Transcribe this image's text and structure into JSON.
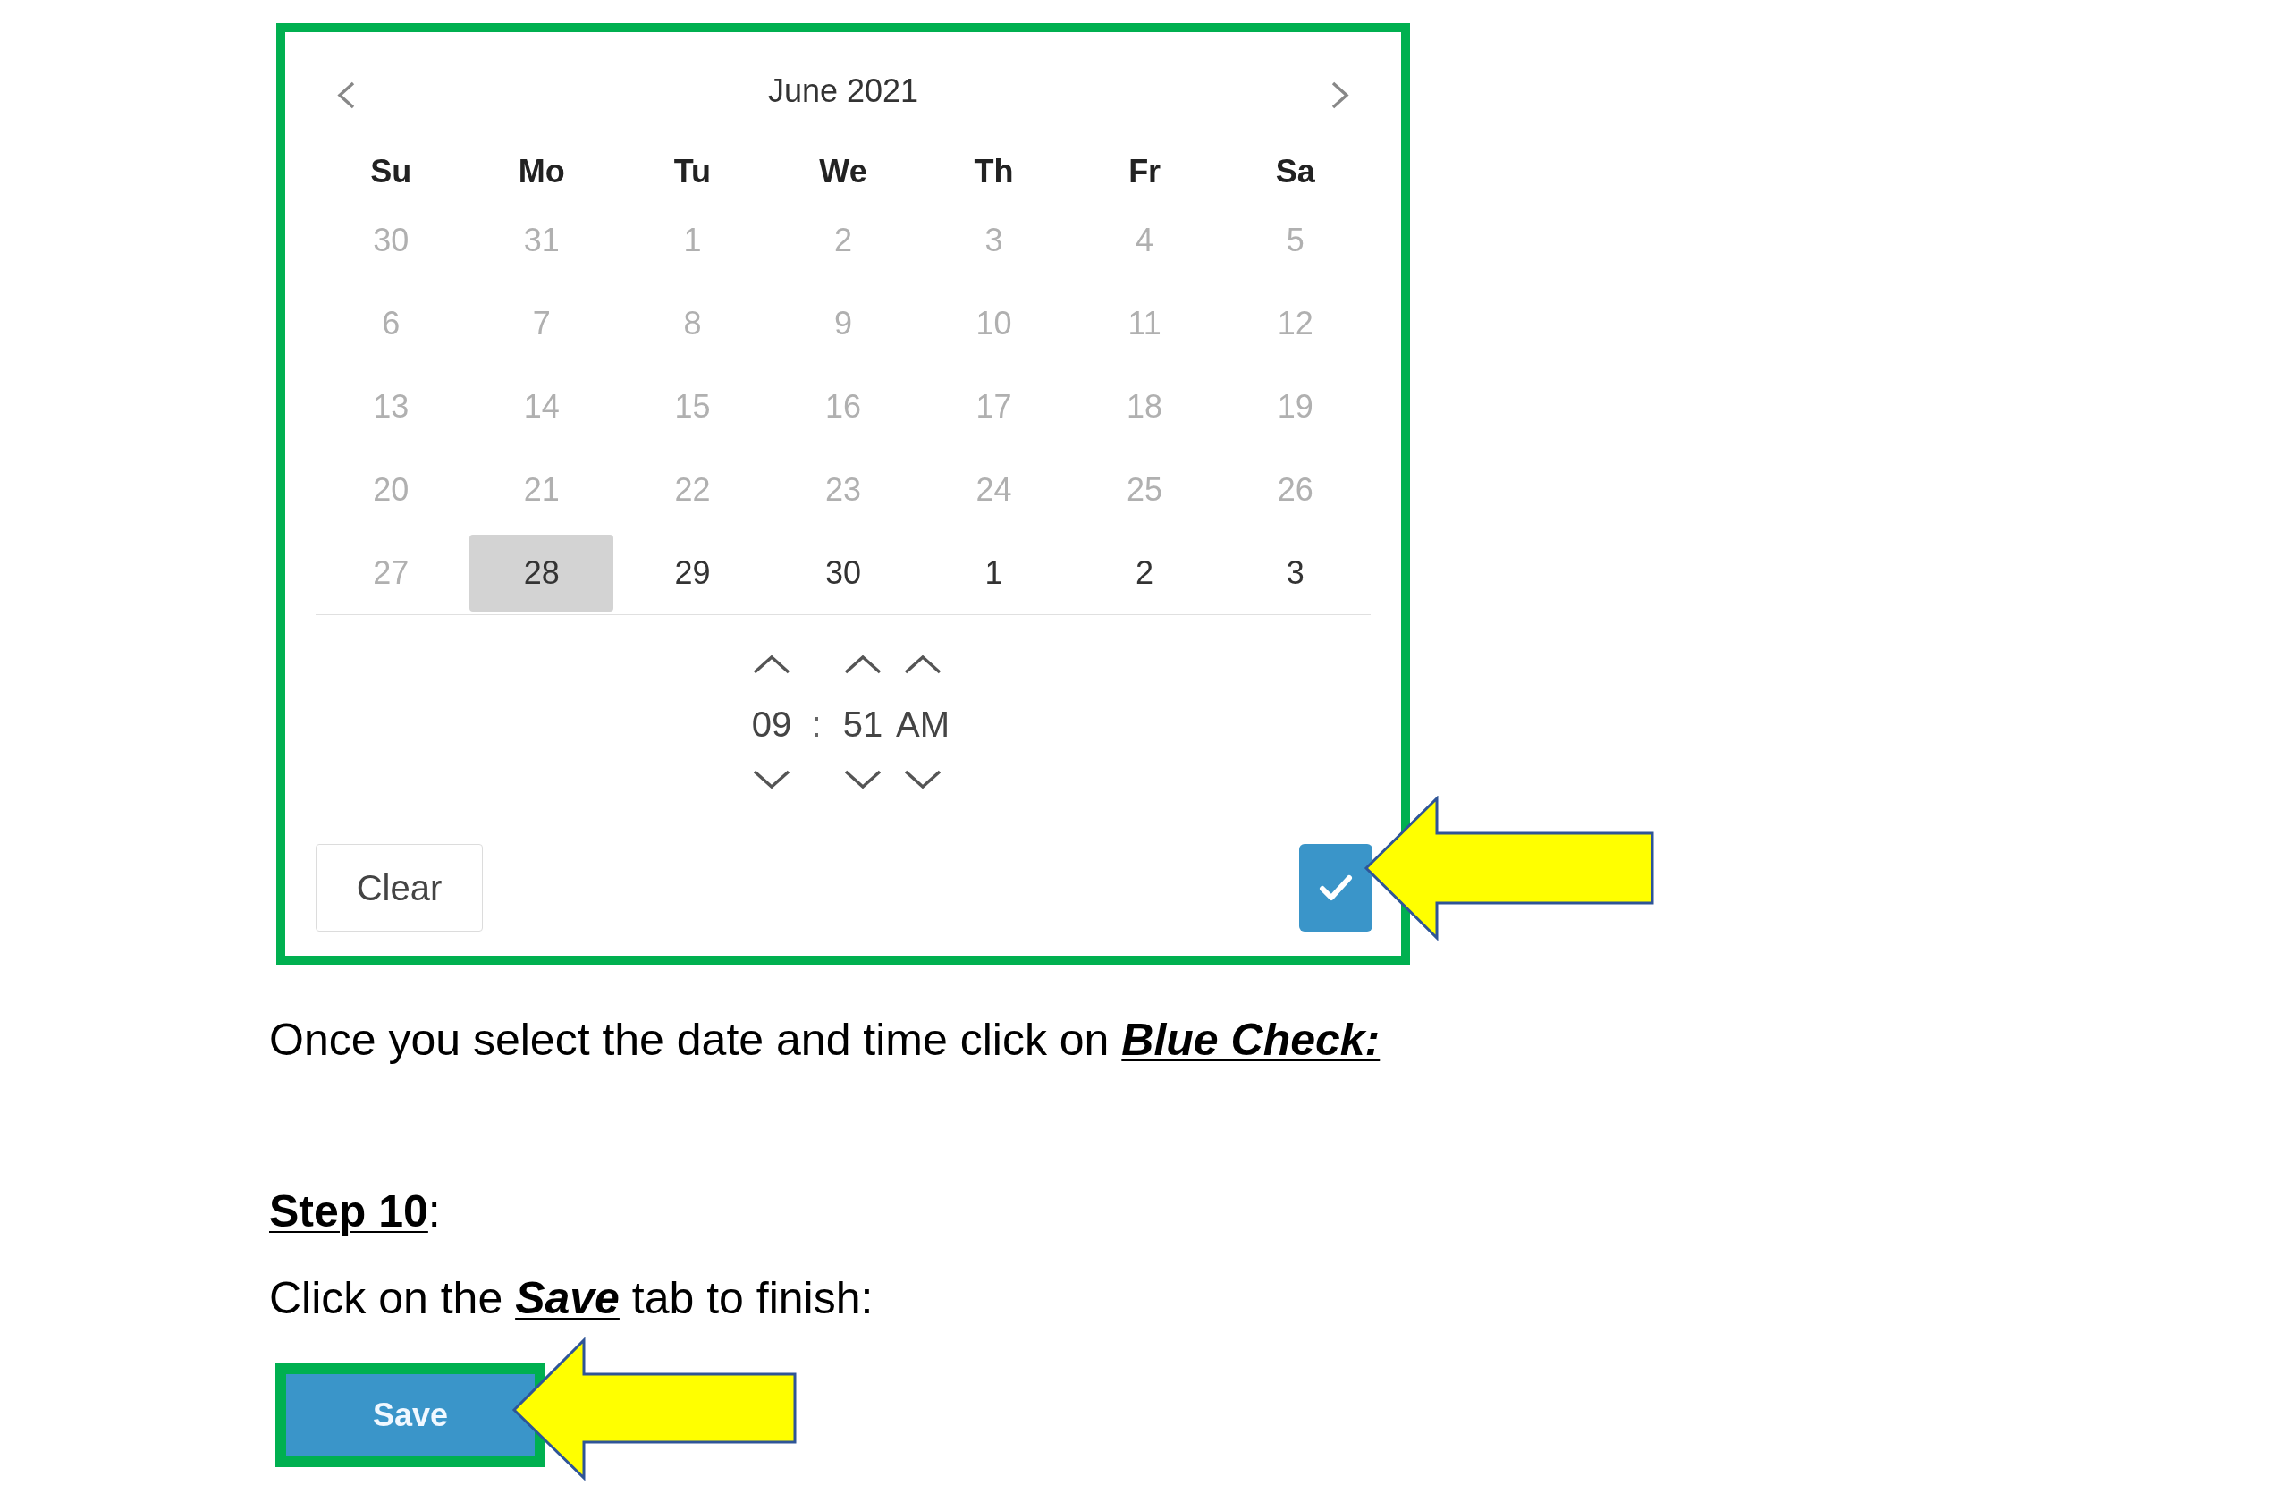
{
  "calendar": {
    "title": "June 2021",
    "weekdays": [
      "Su",
      "Mo",
      "Tu",
      "We",
      "Th",
      "Fr",
      "Sa"
    ],
    "weeks": [
      [
        {
          "label": "30",
          "disabled": true,
          "selected": false
        },
        {
          "label": "31",
          "disabled": true,
          "selected": false
        },
        {
          "label": "1",
          "disabled": true,
          "selected": false
        },
        {
          "label": "2",
          "disabled": true,
          "selected": false
        },
        {
          "label": "3",
          "disabled": true,
          "selected": false
        },
        {
          "label": "4",
          "disabled": true,
          "selected": false
        },
        {
          "label": "5",
          "disabled": true,
          "selected": false
        }
      ],
      [
        {
          "label": "6",
          "disabled": true,
          "selected": false
        },
        {
          "label": "7",
          "disabled": true,
          "selected": false
        },
        {
          "label": "8",
          "disabled": true,
          "selected": false
        },
        {
          "label": "9",
          "disabled": true,
          "selected": false
        },
        {
          "label": "10",
          "disabled": true,
          "selected": false
        },
        {
          "label": "11",
          "disabled": true,
          "selected": false
        },
        {
          "label": "12",
          "disabled": true,
          "selected": false
        }
      ],
      [
        {
          "label": "13",
          "disabled": true,
          "selected": false
        },
        {
          "label": "14",
          "disabled": true,
          "selected": false
        },
        {
          "label": "15",
          "disabled": true,
          "selected": false
        },
        {
          "label": "16",
          "disabled": true,
          "selected": false
        },
        {
          "label": "17",
          "disabled": true,
          "selected": false
        },
        {
          "label": "18",
          "disabled": true,
          "selected": false
        },
        {
          "label": "19",
          "disabled": true,
          "selected": false
        }
      ],
      [
        {
          "label": "20",
          "disabled": true,
          "selected": false
        },
        {
          "label": "21",
          "disabled": true,
          "selected": false
        },
        {
          "label": "22",
          "disabled": true,
          "selected": false
        },
        {
          "label": "23",
          "disabled": true,
          "selected": false
        },
        {
          "label": "24",
          "disabled": true,
          "selected": false
        },
        {
          "label": "25",
          "disabled": true,
          "selected": false
        },
        {
          "label": "26",
          "disabled": true,
          "selected": false
        }
      ],
      [
        {
          "label": "27",
          "disabled": true,
          "selected": false
        },
        {
          "label": "28",
          "disabled": false,
          "selected": true
        },
        {
          "label": "29",
          "disabled": false,
          "selected": false
        },
        {
          "label": "30",
          "disabled": false,
          "selected": false
        },
        {
          "label": "1",
          "disabled": false,
          "selected": false
        },
        {
          "label": "2",
          "disabled": false,
          "selected": false
        },
        {
          "label": "3",
          "disabled": false,
          "selected": false
        }
      ]
    ]
  },
  "time_picker": {
    "hour": "09",
    "separator": ":",
    "minute": "51",
    "period": "AM"
  },
  "footer": {
    "clear_button": "Clear"
  },
  "instruction": "Once you select the date and time click on **Blue Check:**",
  "step_heading": "**Step 10**:",
  "step_text": "Click on the **Save** tab to finish:",
  "save_button": "Save"
}
